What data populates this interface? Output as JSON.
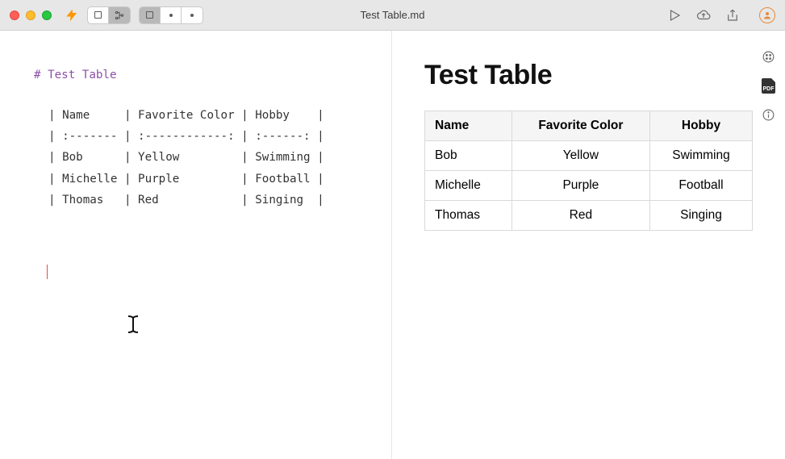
{
  "window": {
    "filename": "Test Table.md"
  },
  "editor": {
    "heading": "# Test Table",
    "table_raw": "| Name     | Favorite Color | Hobby    |\n| :------- | :------------: | :------: |\n| Bob      | Yellow         | Swimming |\n| Michelle | Purple         | Football |\n| Thomas   | Red            | Singing  |"
  },
  "preview": {
    "title": "Test Table",
    "headers": [
      "Name",
      "Favorite Color",
      "Hobby"
    ],
    "rows": [
      [
        "Bob",
        "Yellow",
        "Swimming"
      ],
      [
        "Michelle",
        "Purple",
        "Football"
      ],
      [
        "Thomas",
        "Red",
        "Singing"
      ]
    ]
  },
  "sidebar": {
    "pdf_label": "PDF"
  }
}
